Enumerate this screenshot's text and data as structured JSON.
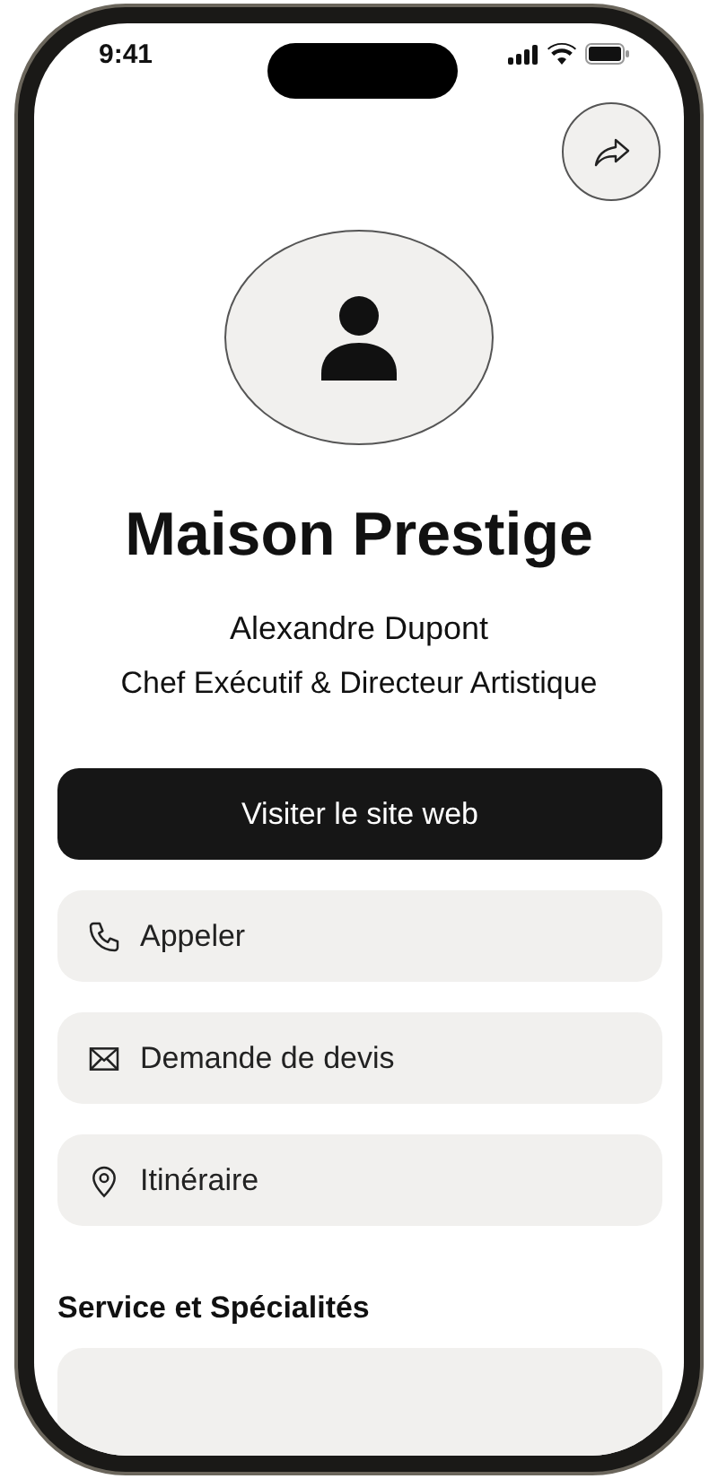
{
  "status_bar": {
    "time": "9:41"
  },
  "profile": {
    "company": "Maison Prestige",
    "name": "Alexandre Dupont",
    "role": "Chef Exécutif & Directeur Artistique"
  },
  "actions": [
    {
      "kind": "primary",
      "label": "Visiter le site web"
    },
    {
      "kind": "phone",
      "label": "Appeler"
    },
    {
      "kind": "mail",
      "label": "Demande de devis"
    },
    {
      "kind": "location",
      "label": "Itinéraire"
    }
  ],
  "section": {
    "title": "Service et Spécialités"
  }
}
